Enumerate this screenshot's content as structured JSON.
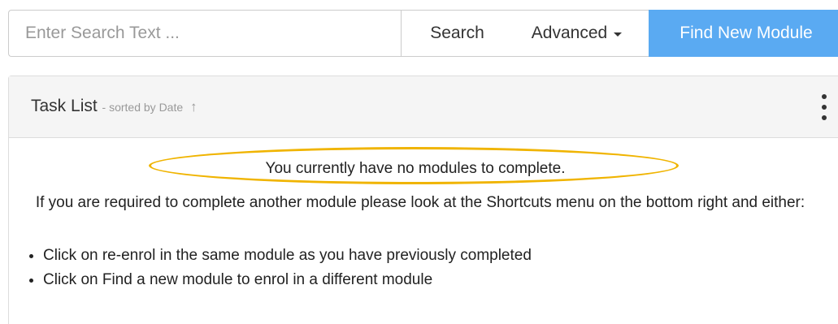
{
  "search": {
    "placeholder": "Enter Search Text ...",
    "value": "",
    "search_button": "Search",
    "advanced_button": "Advanced",
    "find_new_button": "Find New Module"
  },
  "task_panel": {
    "title": "Task List",
    "subtitle": "- sorted by Date",
    "sort_arrow": "↑",
    "empty_message": "You currently have no modules to complete.",
    "info_text": "If you are required to complete another module please look at the Shortcuts menu on the bottom right and either:",
    "options": [
      "Click on re-enrol in the same module as you have previously completed",
      "Click on Find a new module to enrol in a different module"
    ]
  },
  "colors": {
    "primary_button": "#5aaaf2",
    "highlight_oval": "#f0b400",
    "panel_heading_bg": "#f5f5f5"
  }
}
